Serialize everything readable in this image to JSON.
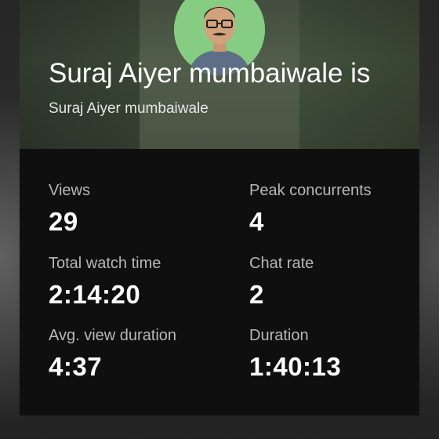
{
  "stream": {
    "title": "Suraj Aiyer mumbaiwale is",
    "channel": "Suraj Aiyer mumbaiwale"
  },
  "stats": {
    "views": {
      "label": "Views",
      "value": "29"
    },
    "peak_concurrents": {
      "label": "Peak concurrents",
      "value": "4"
    },
    "total_watch_time": {
      "label": "Total watch time",
      "value": "2:14:20"
    },
    "chat_rate": {
      "label": "Chat rate",
      "value": "2"
    },
    "avg_view_duration": {
      "label": "Avg. view duration",
      "value": "4:37"
    },
    "duration": {
      "label": "Duration",
      "value": "1:40:13"
    }
  },
  "colors": {
    "card_background": "#0f0f0f",
    "header_background": "#3b4a36",
    "label_text": "#b7b7b7",
    "value_text": "#ffffff"
  }
}
